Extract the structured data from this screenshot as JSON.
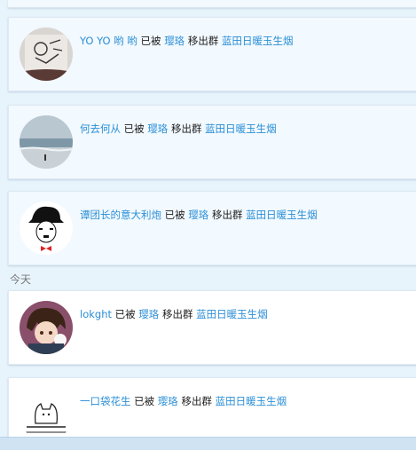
{
  "text": {
    "removed_by": "已被",
    "removed_from_group": "移出群"
  },
  "section_label": "今天",
  "events": [
    {
      "user": "YO YO 哟 哟",
      "operator": "璎珞",
      "group": "蓝田日暖玉生烟",
      "avatar": "sketch-avatar"
    },
    {
      "user": "何去何从",
      "operator": "璎珞",
      "group": "蓝田日暖玉生烟",
      "avatar": "beach-avatar"
    },
    {
      "user": "谭团长的意大利炮",
      "operator": "璎珞",
      "group": "蓝田日暖玉生烟",
      "avatar": "chaplin-avatar"
    },
    {
      "user": "lokght",
      "operator": "璎珞",
      "group": "蓝田日暖玉生烟",
      "avatar": "anime-avatar"
    },
    {
      "user": "一口袋花生",
      "operator": "璎珞",
      "group": "蓝田日暖玉生烟",
      "avatar": "cat-avatar"
    }
  ],
  "colors": {
    "link": "#2b8fd6",
    "background": "#e8f4fc",
    "card": "#f2f9ff"
  }
}
